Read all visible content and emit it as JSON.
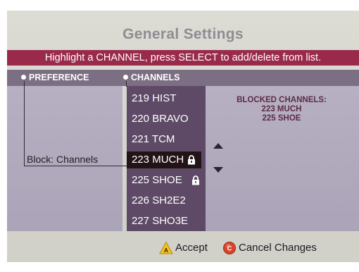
{
  "title": "General Settings",
  "instruction": "Highlight a CHANNEL, press SELECT to add/delete from list.",
  "columns": {
    "preference": "PREFERENCE",
    "channels": "CHANNELS"
  },
  "preference_value": "Block: Channels",
  "channels": [
    {
      "label": "219 HIST",
      "locked": false,
      "selected": false
    },
    {
      "label": "220 BRAVO",
      "locked": false,
      "selected": false
    },
    {
      "label": "221 TCM",
      "locked": false,
      "selected": false
    },
    {
      "label": "223 MUCH",
      "locked": true,
      "selected": true
    },
    {
      "label": "225 SHOE",
      "locked": true,
      "selected": false
    },
    {
      "label": "226 SH2E2",
      "locked": false,
      "selected": false
    },
    {
      "label": "227 SHO3E",
      "locked": false,
      "selected": false
    }
  ],
  "blocked": {
    "heading": "BLOCKED CHANNELS:",
    "items": [
      "223 MUCH",
      "225 SHOE"
    ]
  },
  "buttons": {
    "accept": {
      "key": "A",
      "label": "Accept",
      "color": "#f1c21b"
    },
    "cancel": {
      "key": "C",
      "label": "Cancel Changes",
      "color": "#d9452c"
    }
  },
  "colors": {
    "accent_bar": "#9a2a4c",
    "header_row": "#7d6f83",
    "list_bg": "#5e4a66",
    "selected_bg": "#221416",
    "blocked_text": "#5c2c47"
  },
  "icons": {
    "lock": "lock-icon",
    "up": "arrow-up-icon",
    "down": "arrow-down-icon"
  }
}
